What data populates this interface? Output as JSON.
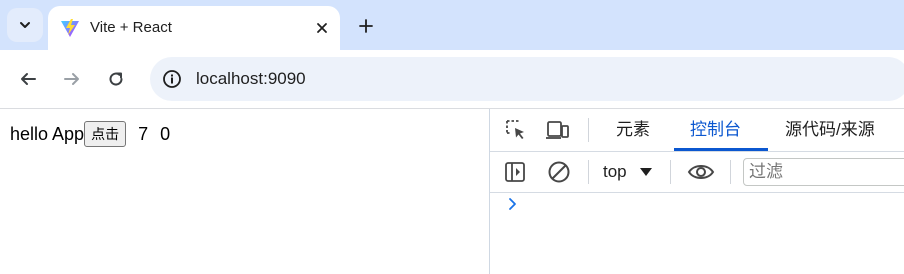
{
  "browser": {
    "tab": {
      "title": "Vite + React"
    },
    "address": {
      "url": "localhost:9090"
    }
  },
  "page": {
    "text": "hello App",
    "button_label": "点击",
    "values": [
      "7",
      "0"
    ]
  },
  "devtools": {
    "tabs": [
      {
        "label": "元素"
      },
      {
        "label": "控制台",
        "active": true
      },
      {
        "label": "源代码/来源"
      }
    ],
    "context": "top",
    "filter_placeholder": "过滤"
  },
  "colors": {
    "tabstrip": "#d3e3fd",
    "accent": "#0b57d0",
    "omnibox": "#edf2fa"
  }
}
